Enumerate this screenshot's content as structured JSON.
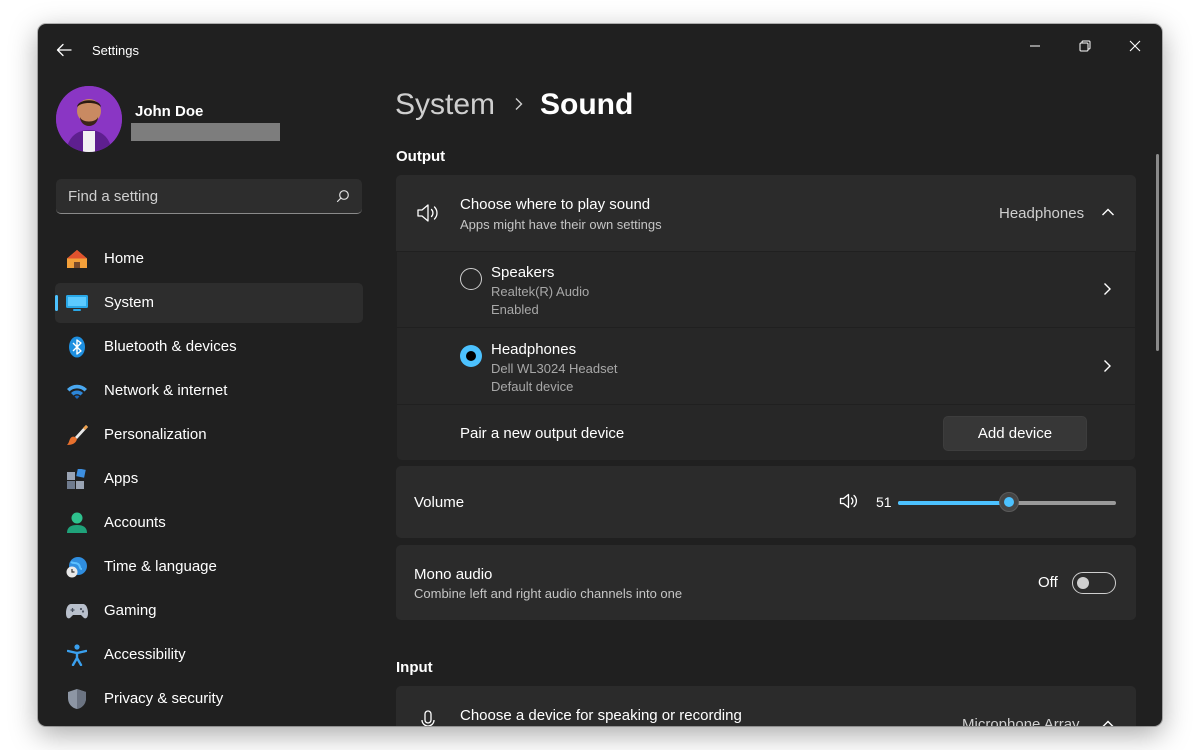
{
  "app": {
    "title": "Settings"
  },
  "user": {
    "name": "John Doe"
  },
  "search": {
    "placeholder": "Find a setting"
  },
  "nav": [
    {
      "label": "Home",
      "icon": "home-icon"
    },
    {
      "label": "System",
      "icon": "system-icon",
      "active": true
    },
    {
      "label": "Bluetooth & devices",
      "icon": "bluetooth-icon"
    },
    {
      "label": "Network & internet",
      "icon": "wifi-icon"
    },
    {
      "label": "Personalization",
      "icon": "brush-icon"
    },
    {
      "label": "Apps",
      "icon": "apps-icon"
    },
    {
      "label": "Accounts",
      "icon": "accounts-icon"
    },
    {
      "label": "Time & language",
      "icon": "clock-globe-icon"
    },
    {
      "label": "Gaming",
      "icon": "gamepad-icon"
    },
    {
      "label": "Accessibility",
      "icon": "accessibility-icon"
    },
    {
      "label": "Privacy & security",
      "icon": "shield-icon"
    }
  ],
  "breadcrumb": {
    "parent": "System",
    "current": "Sound"
  },
  "output": {
    "section_title": "Output",
    "choose": {
      "title": "Choose where to play sound",
      "subtitle": "Apps might have their own settings",
      "value": "Headphones"
    },
    "devices": [
      {
        "name": "Speakers",
        "detail": "Realtek(R) Audio",
        "status": "Enabled",
        "selected": false
      },
      {
        "name": "Headphones",
        "detail": "Dell WL3024 Headset",
        "status": "Default device",
        "selected": true
      }
    ],
    "pair": {
      "label": "Pair a new output device",
      "button": "Add device"
    },
    "volume": {
      "label": "Volume",
      "value": "51",
      "level": 51
    },
    "mono": {
      "title": "Mono audio",
      "subtitle": "Combine left and right audio channels into one",
      "state": "Off"
    }
  },
  "input": {
    "section_title": "Input",
    "choose": {
      "title": "Choose a device for speaking or recording",
      "value": "Microphone Array"
    }
  },
  "colors": {
    "accent": "#4cc2ff",
    "window_bg": "#202020",
    "card_bg": "#2b2b2b"
  }
}
